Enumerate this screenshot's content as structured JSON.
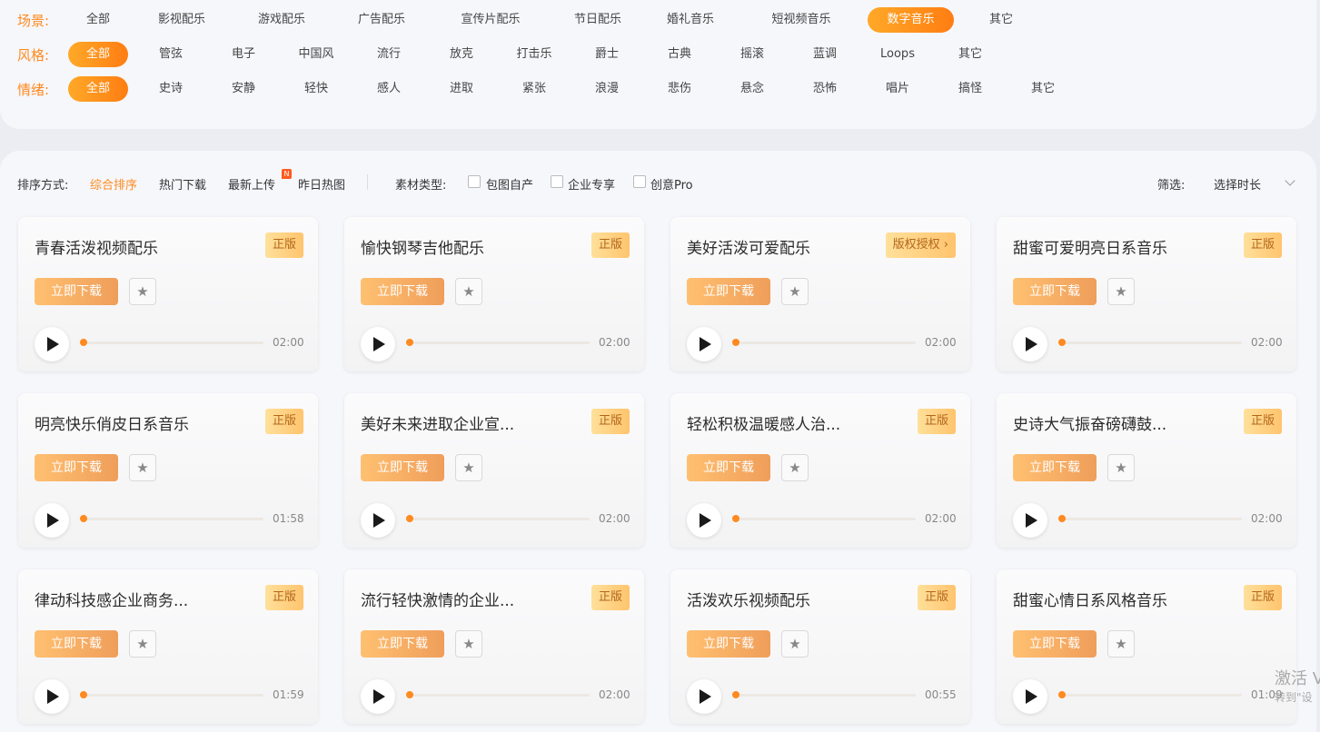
{
  "filters": {
    "scene": {
      "label": "场景:",
      "options": [
        "全部",
        "影视配乐",
        "游戏配乐",
        "广告配乐",
        "宣传片配乐",
        "节日配乐",
        "婚礼音乐",
        "短视频音乐",
        "数字音乐",
        "其它"
      ],
      "active_index": 8
    },
    "style": {
      "label": "风格:",
      "options": [
        "全部",
        "管弦",
        "电子",
        "中国风",
        "流行",
        "放克",
        "打击乐",
        "爵士",
        "古典",
        "摇滚",
        "蓝调",
        "Loops",
        "其它"
      ],
      "active_index": 0
    },
    "mood": {
      "label": "情绪:",
      "options": [
        "全部",
        "史诗",
        "安静",
        "轻快",
        "感人",
        "进取",
        "紧张",
        "浪漫",
        "悲伤",
        "悬念",
        "恐怖",
        "唱片",
        "搞怪",
        "其它"
      ],
      "active_index": 0
    }
  },
  "sortbar": {
    "sort_label": "排序方式:",
    "sorts": [
      "综合排序",
      "热门下载",
      "最新上传",
      "昨日热图"
    ],
    "new_badge": "N",
    "material_label": "素材类型:",
    "checkboxes": [
      "包图自产",
      "企业专享",
      "创意Pro"
    ],
    "filter_label": "筛选:",
    "duration_select": "选择时长"
  },
  "cards": [
    {
      "title": "青春活泼视频配乐",
      "license": "正版",
      "duration": "02:00"
    },
    {
      "title": "愉快钢琴吉他配乐",
      "license": "正版",
      "duration": "02:00"
    },
    {
      "title": "美好活泼可爱配乐",
      "license": "版权授权 ›",
      "duration": "02:00"
    },
    {
      "title": "甜蜜可爱明亮日系音乐",
      "license": "正版",
      "duration": "02:00"
    },
    {
      "title": "明亮快乐俏皮日系音乐",
      "license": "正版",
      "duration": "01:58"
    },
    {
      "title": "美好未来进取企业宣...",
      "license": "正版",
      "duration": "02:00"
    },
    {
      "title": "轻松积极温暖感人治...",
      "license": "正版",
      "duration": "02:00"
    },
    {
      "title": "史诗大气振奋磅礴鼓...",
      "license": "正版",
      "duration": "02:00"
    },
    {
      "title": "律动科技感企业商务...",
      "license": "正版",
      "duration": "01:59"
    },
    {
      "title": "流行轻快激情的企业...",
      "license": "正版",
      "duration": "02:00"
    },
    {
      "title": "活泼欢乐视频配乐",
      "license": "正版",
      "duration": "00:55"
    },
    {
      "title": "甜蜜心情日系风格音乐",
      "license": "正版",
      "duration": "01:09"
    }
  ],
  "card_labels": {
    "download": "立即下载",
    "fav_icon": "star-icon",
    "play_icon": "play-icon"
  },
  "watermark": {
    "line1": "激活 V",
    "line2": "转到\"设"
  },
  "colors": {
    "accent": "#ff8a1f",
    "button": "#f0a35c",
    "license_bg": "#ffd47f"
  }
}
